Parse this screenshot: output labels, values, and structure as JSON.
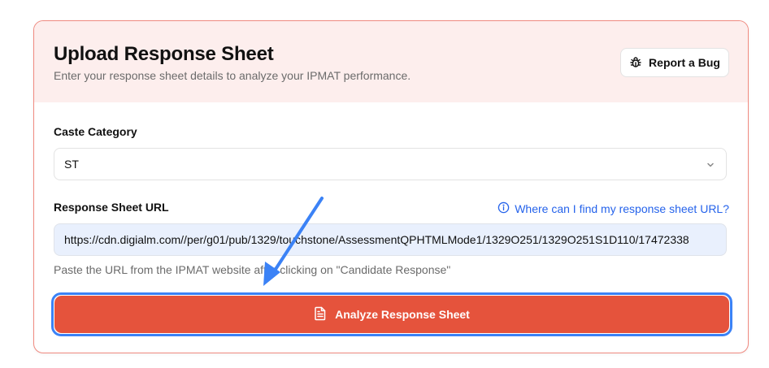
{
  "card": {
    "title": "Upload Response Sheet",
    "subtitle": "Enter your response sheet details to analyze your IPMAT performance.",
    "report_bug_label": "Report a Bug",
    "report_bug_icon": "bug-icon"
  },
  "form": {
    "caste_label": "Caste Category",
    "caste_value": "ST",
    "url_label": "Response Sheet URL",
    "help_link": "Where can I find my response sheet URL?",
    "help_icon": "info-icon",
    "url_value": "https://cdn.digialm.com//per/g01/pub/1329/touchstone/AssessmentQPHTMLMode1/1329O251/1329O251S1D110/17472338",
    "hint": "Paste the URL from the IPMAT website after clicking on \"Candidate Response\"",
    "analyze_label": "Analyze Response Sheet",
    "analyze_icon": "document-icon"
  },
  "colors": {
    "header_bg": "#fdeeed",
    "accent": "#e5533c",
    "link": "#2563eb",
    "focus_ring": "#3b82f6",
    "annotation_arrow": "#3b82f6"
  }
}
